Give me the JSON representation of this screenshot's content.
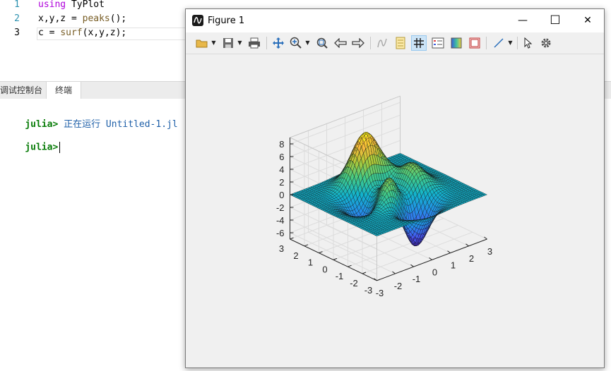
{
  "editor": {
    "lines": [
      {
        "num": "1",
        "kw": "using",
        "rest": " TyPlot"
      },
      {
        "num": "2",
        "pre": "x,y,z = ",
        "fn": "peaks",
        "post": "();"
      },
      {
        "num": "3",
        "pre": "c = ",
        "fn": "surf",
        "post": "(x,y,z);"
      }
    ]
  },
  "panel": {
    "tabs": [
      {
        "label": "调试控制台"
      },
      {
        "label": "终端"
      }
    ]
  },
  "terminal": {
    "prompt": "julia>",
    "running_text": "正在运行 Untitled-1.jl"
  },
  "figure": {
    "title": "Figure 1",
    "minimize": "—",
    "maximize": "☐",
    "close": "✕",
    "toolbar": [
      "open-icon",
      "save-icon",
      "print-icon",
      "pan-icon",
      "zoom-in-icon",
      "zoom-fit-icon",
      "back-icon",
      "forward-icon",
      "data-cursor-icon",
      "edit-icon",
      "grid-icon",
      "legend-icon",
      "colorbar-icon",
      "box-icon",
      "line-icon",
      "select-icon",
      "settings-icon"
    ]
  },
  "chart_data": {
    "type": "surface",
    "function": "peaks",
    "colormap": "parula",
    "grid": true,
    "zticks": [
      "8",
      "6",
      "4",
      "2",
      "0",
      "-2",
      "-4",
      "-6"
    ],
    "yticks": [
      "3",
      "2",
      "1",
      "0",
      "-1",
      "-2",
      "-3"
    ],
    "xticks": [
      "-3",
      "-2",
      "-1",
      "0",
      "1",
      "2",
      "3"
    ],
    "xlim": [
      -3,
      3
    ],
    "ylim": [
      -3,
      3
    ],
    "zlim": [
      -7,
      9
    ]
  }
}
